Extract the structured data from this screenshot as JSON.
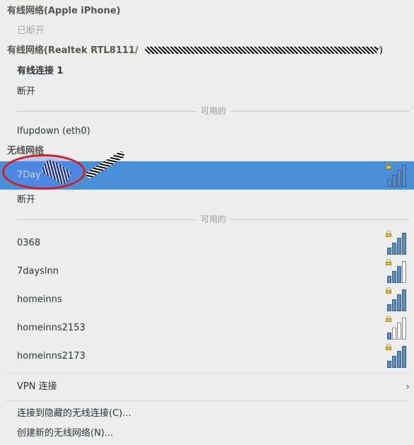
{
  "wired_sections": [
    {
      "header": "有线网络(Apple iPhone)",
      "status": "已断开"
    },
    {
      "header": "有线网络(Realtek RTL8111/",
      "header_suffix": "r)"
    }
  ],
  "wired_connection": {
    "name": "有线连接 1",
    "disconnect": "断开",
    "available_label": "可用的",
    "ifupdown": "Ifupdown (eth0)"
  },
  "wireless": {
    "header": "无线网络",
    "selected_network": "7Day",
    "disconnect": "断开",
    "available_label": "可用的",
    "networks": [
      {
        "name": "0368",
        "signal": 4,
        "locked": true
      },
      {
        "name": "7dayslnn",
        "signal": 3,
        "locked": true
      },
      {
        "name": "homeinns",
        "signal": 4,
        "locked": true
      },
      {
        "name": "homeinns2153",
        "signal": 1,
        "locked": true
      },
      {
        "name": "homeinns2173",
        "signal": 4,
        "locked": true
      }
    ],
    "selected_signal": 4
  },
  "vpn": {
    "label": "VPN 连接",
    "chevron": "›"
  },
  "actions": {
    "hidden": "连接到隐藏的无线连接(C)...",
    "create": "创建新的无线网络(N)..."
  },
  "colors": {
    "selection": "#4a90d9",
    "annotation": "#d61e1e"
  }
}
